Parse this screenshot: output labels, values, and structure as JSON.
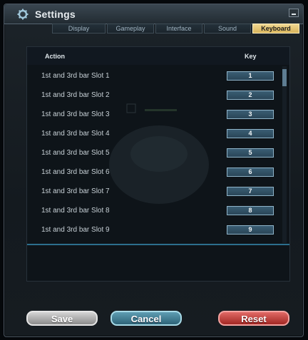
{
  "window": {
    "title": "Settings"
  },
  "tabs": [
    {
      "label": "Display"
    },
    {
      "label": "Gameplay"
    },
    {
      "label": "Interface"
    },
    {
      "label": "Sound"
    },
    {
      "label": "Keyboard",
      "active": true
    }
  ],
  "table": {
    "headers": {
      "action": "Action",
      "key": "Key"
    },
    "rows": [
      {
        "action": "1st and 3rd bar Slot 1",
        "key": "1"
      },
      {
        "action": "1st and 3rd bar Slot 2",
        "key": "2"
      },
      {
        "action": "1st and 3rd bar Slot 3",
        "key": "3"
      },
      {
        "action": "1st and 3rd bar Slot 4",
        "key": "4"
      },
      {
        "action": "1st and 3rd bar Slot 5",
        "key": "5"
      },
      {
        "action": "1st and 3rd bar Slot 6",
        "key": "6"
      },
      {
        "action": "1st and 3rd bar Slot 7",
        "key": "7"
      },
      {
        "action": "1st and 3rd bar Slot 8",
        "key": "8"
      },
      {
        "action": "1st and 3rd bar Slot 9",
        "key": "9"
      }
    ]
  },
  "buttons": {
    "save": "Save",
    "cancel": "Cancel",
    "reset": "Reset"
  },
  "colors": {
    "active_tab": "#e8c66f",
    "key_box": "#30506a",
    "save": "#a9a9a9",
    "cancel": "#3f7e94",
    "reset": "#c03a36"
  },
  "icons": {
    "title": "gear-icon",
    "minimize": "minimize-icon"
  }
}
